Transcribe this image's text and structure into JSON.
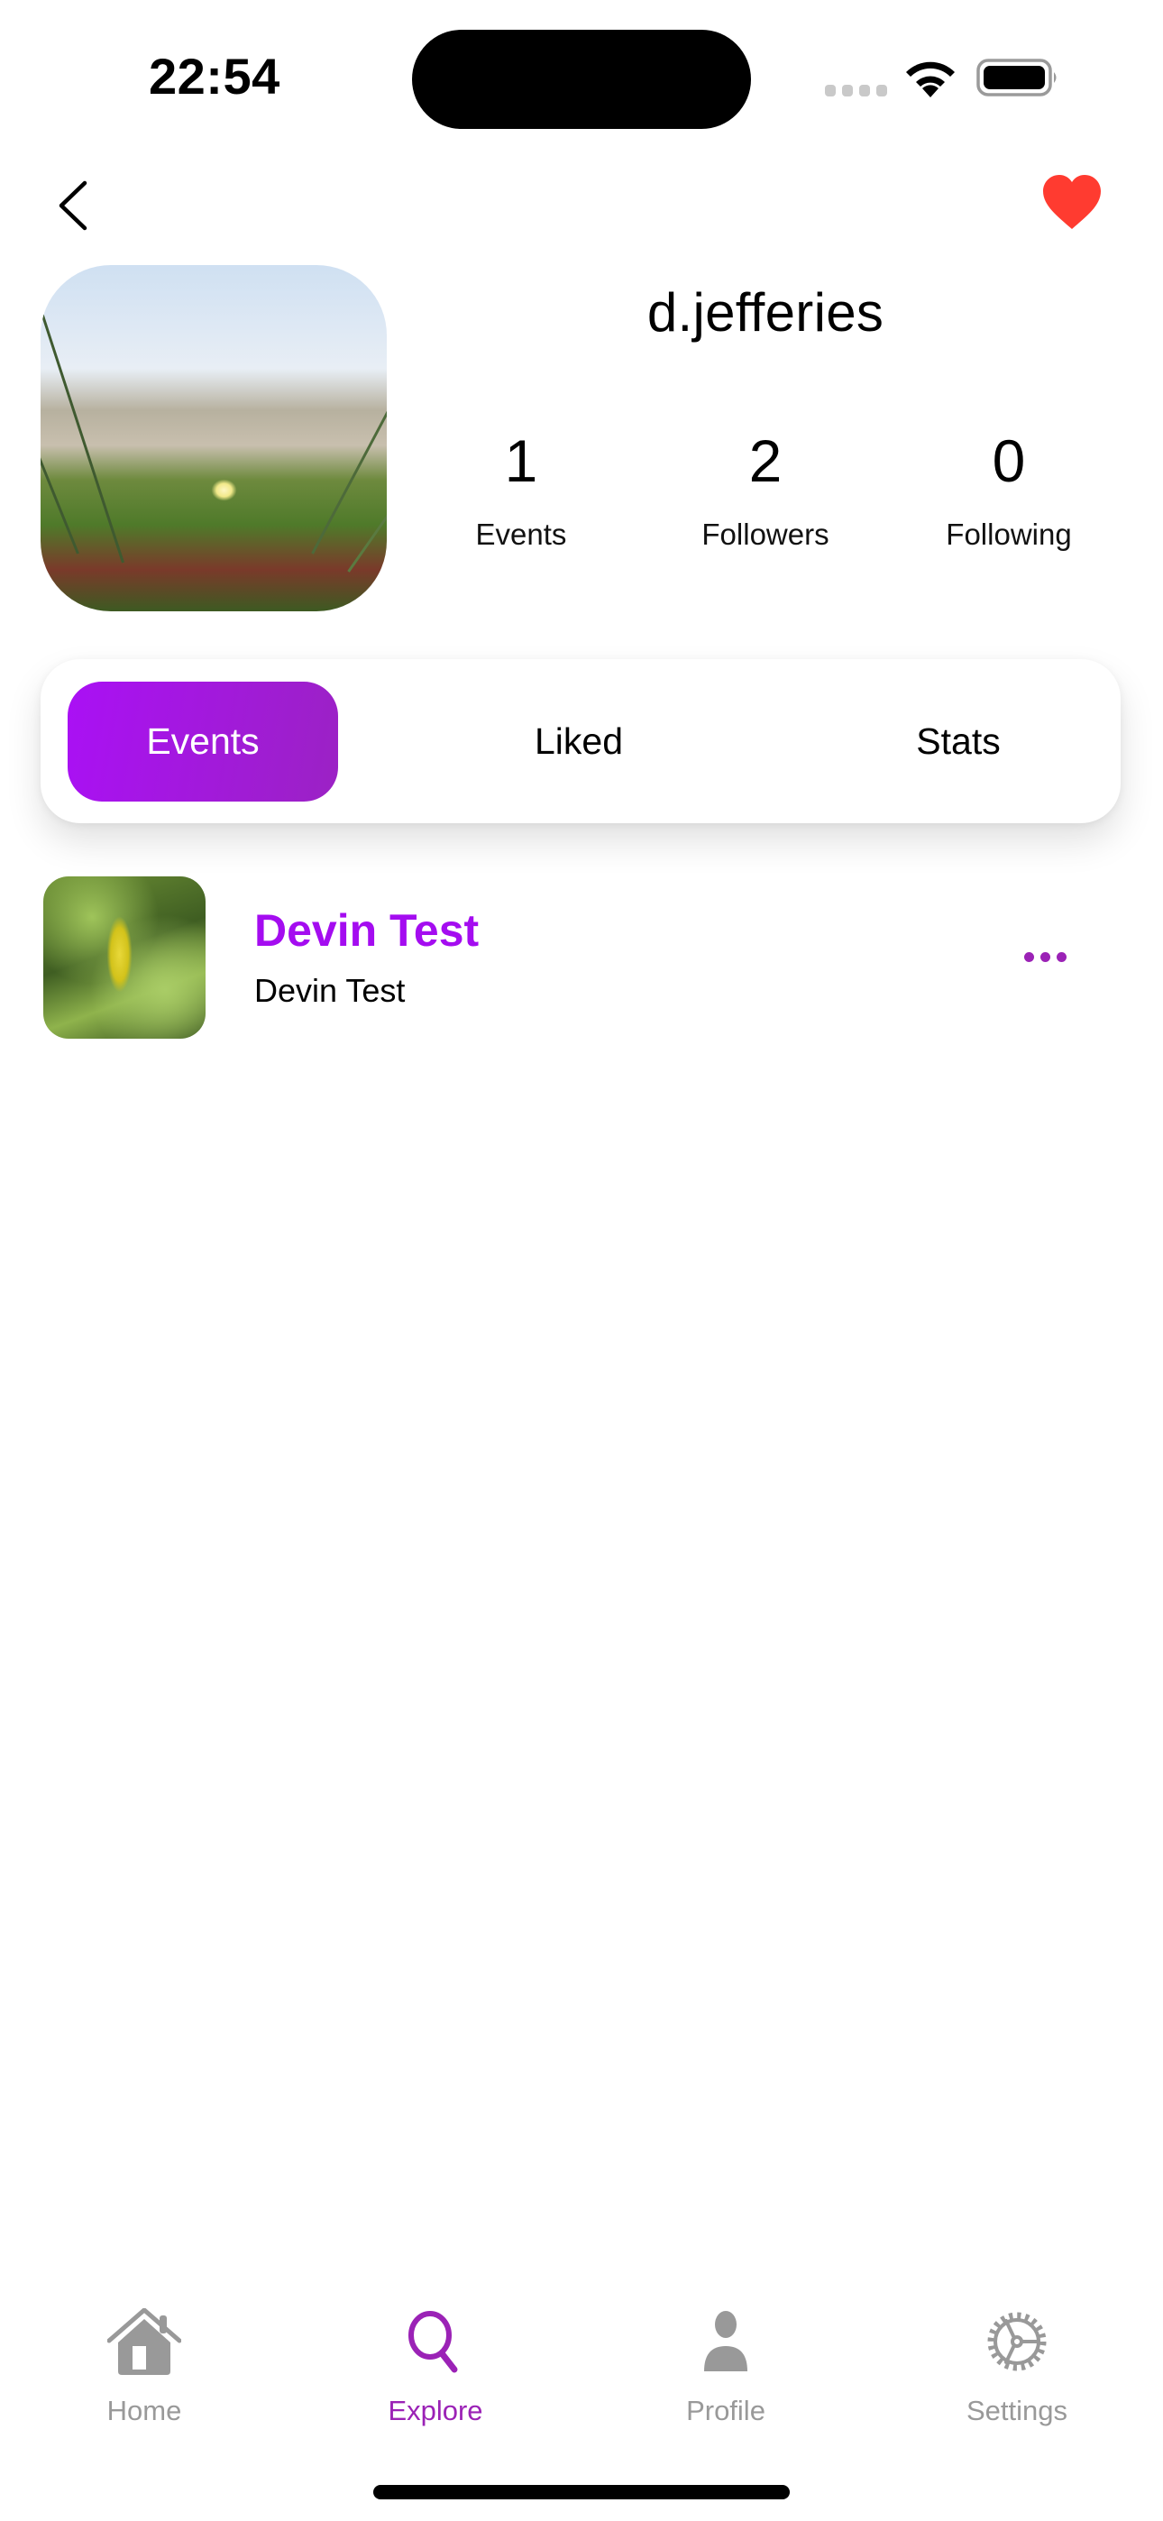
{
  "status_bar": {
    "time": "22:54"
  },
  "header": {
    "back_icon": "chevron-left-icon",
    "favorite_icon": "heart-filled-icon",
    "favorite_color": "#FF3B30"
  },
  "profile": {
    "username": "d.jefferies",
    "avatar": "beach-dune-flower-photo",
    "stats": [
      {
        "value": "1",
        "label": "Events"
      },
      {
        "value": "2",
        "label": "Followers"
      },
      {
        "value": "0",
        "label": "Following"
      }
    ]
  },
  "segments": {
    "selected": "Events",
    "items": [
      {
        "label": "Events"
      },
      {
        "label": "Liked"
      },
      {
        "label": "Stats"
      }
    ],
    "accent_gradient": [
      "#AA10F5",
      "#9B22C4"
    ]
  },
  "events": [
    {
      "title": "Devin Test",
      "subtitle": "Devin Test",
      "thumbnail": "green-leaves-photo",
      "more_icon": "ellipsis-icon"
    }
  ],
  "tab_bar": {
    "active": "Explore",
    "active_color": "#9B22B6",
    "inactive_color": "#999999",
    "items": [
      {
        "label": "Home",
        "icon": "house-icon"
      },
      {
        "label": "Explore",
        "icon": "magnifying-glass-icon"
      },
      {
        "label": "Profile",
        "icon": "person-icon"
      },
      {
        "label": "Settings",
        "icon": "gear-icon"
      }
    ]
  }
}
